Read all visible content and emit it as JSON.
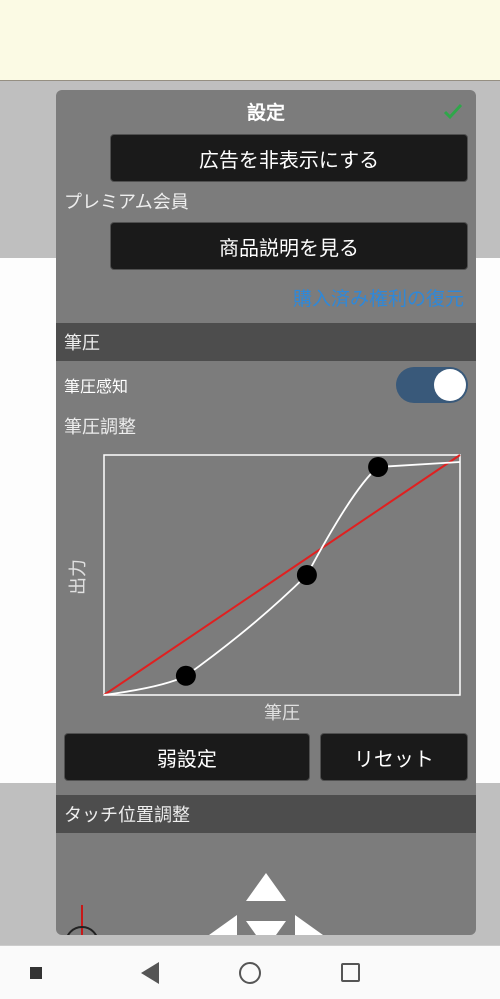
{
  "header": {
    "title": "設定"
  },
  "buttons": {
    "hide_ads": "広告を非表示にする",
    "view_product": "商品説明を見る",
    "weak_setting": "弱設定",
    "reset": "リセット"
  },
  "labels": {
    "premium": "プレミアム会員",
    "restore": "購入済み権利の復元",
    "section_pressure": "筆圧",
    "pressure_sense": "筆圧感知",
    "pressure_adjust": "筆圧調整",
    "axis_y": "出力",
    "axis_x": "筆圧",
    "section_touch": "タッチ位置調整"
  },
  "toggle": {
    "pressure_sense_on": true
  },
  "chart_data": {
    "type": "line",
    "title": "",
    "xlabel": "筆圧",
    "ylabel": "出力",
    "xlim": [
      0,
      1
    ],
    "ylim": [
      0,
      1
    ],
    "series": [
      {
        "name": "reference",
        "x": [
          0,
          1
        ],
        "y": [
          0,
          1
        ],
        "color": "#e02020"
      },
      {
        "name": "curve",
        "x": [
          0,
          0.23,
          0.57,
          0.77,
          1
        ],
        "y": [
          0,
          0.08,
          0.5,
          0.95,
          0.97
        ],
        "color": "#ffffff"
      }
    ],
    "control_points": [
      {
        "x": 0.23,
        "y": 0.08
      },
      {
        "x": 0.57,
        "y": 0.5
      },
      {
        "x": 0.77,
        "y": 0.95
      }
    ]
  }
}
